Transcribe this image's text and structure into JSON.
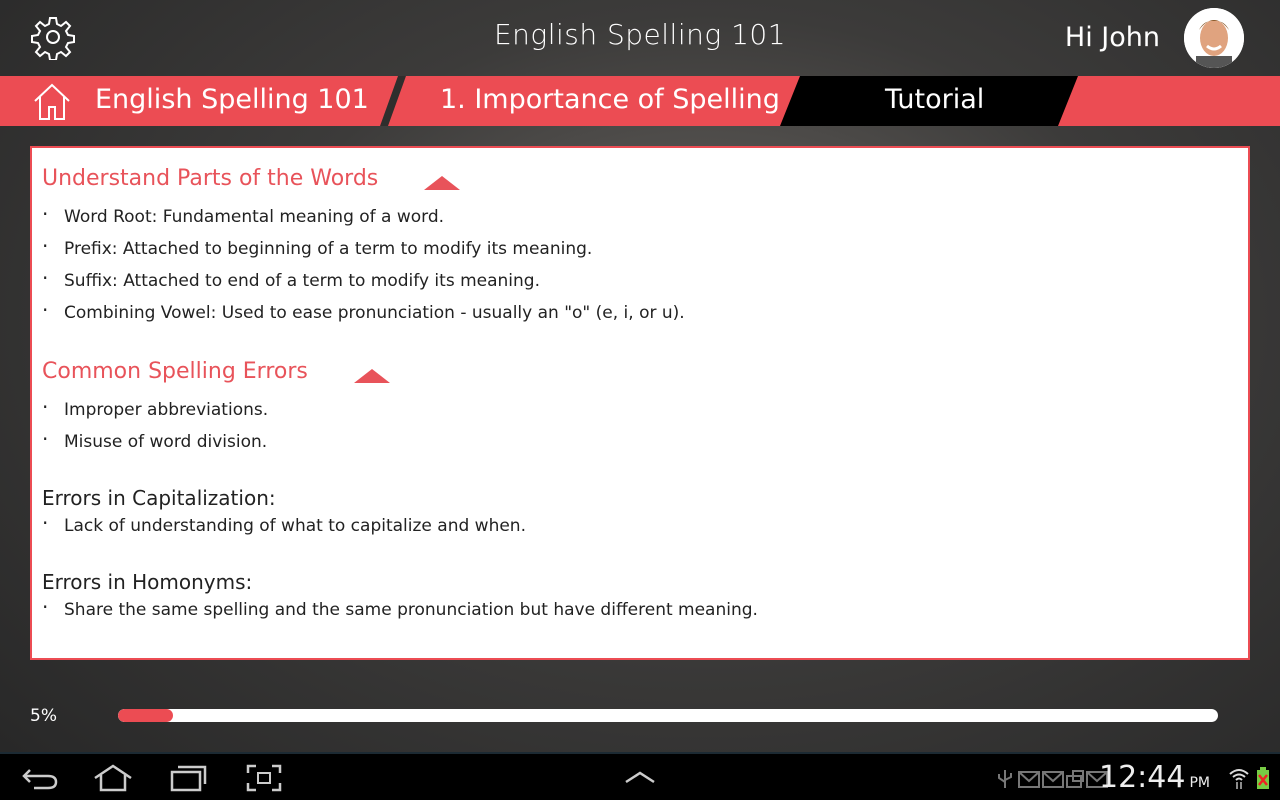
{
  "header": {
    "title": "English Spelling 101",
    "greeting": "Hi John",
    "settings_icon": "gear-icon"
  },
  "breadcrumb": [
    {
      "label": "English Spelling 101",
      "icon": "home-icon"
    },
    {
      "label": "1. Importance of Spelling"
    },
    {
      "label": "Tutorial"
    }
  ],
  "colors": {
    "accent": "#ec4c53",
    "active_crumb": "#000000"
  },
  "content": {
    "sections": [
      {
        "title": "Understand Parts of the Words",
        "items": [
          "Word Root: Fundamental meaning of a word.",
          "Prefix: Attached to beginning of a term to modify its meaning.",
          "Suffix: Attached to end of a term to modify its meaning.",
          "Combining Vowel: Used to ease pronunciation - usually an \"o\" (e, i, or u)."
        ]
      },
      {
        "title": "Common Spelling Errors",
        "items": [
          "Improper abbreviations.",
          "Misuse of word division."
        ]
      }
    ],
    "subsections": [
      {
        "title": "Errors in Capitalization:",
        "items": [
          "Lack of understanding of what to capitalize and when."
        ]
      },
      {
        "title": "Errors in Homonyms:",
        "items": [
          "Share the same spelling and the same pronunciation but have different meaning."
        ]
      }
    ]
  },
  "progress": {
    "label": "5%",
    "value": 5
  },
  "system_bar": {
    "time": "12:44",
    "ampm": "PM"
  }
}
